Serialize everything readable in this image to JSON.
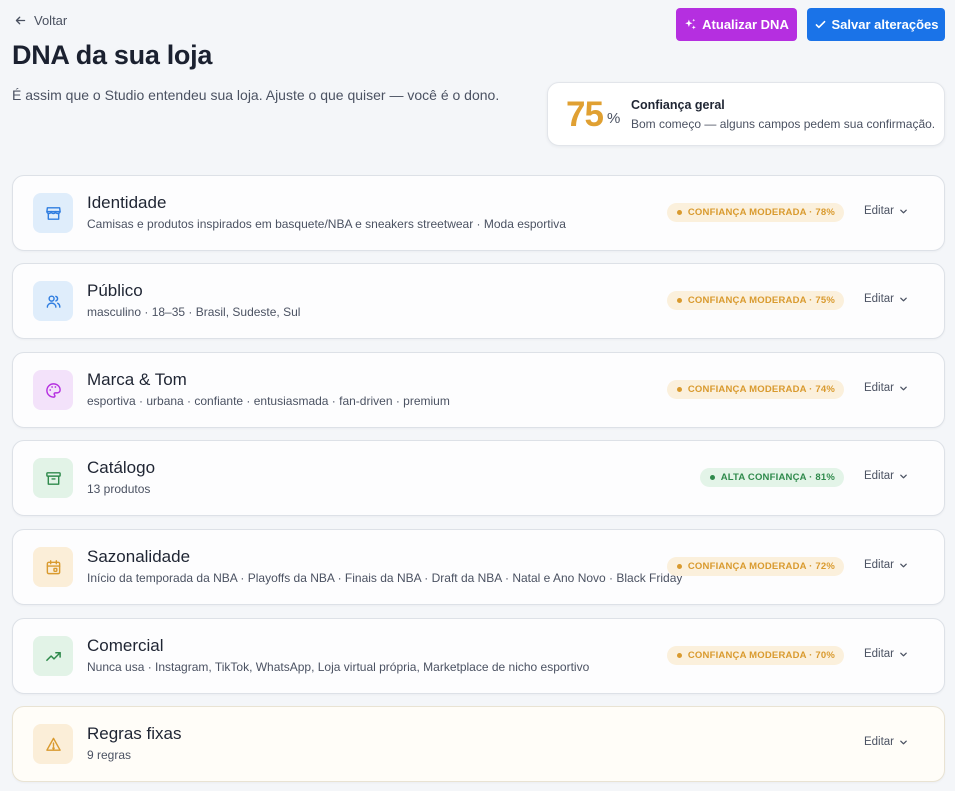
{
  "header": {
    "back_label": "Voltar",
    "title": "DNA da sua loja",
    "subtitle": "É assim que o Studio entendeu sua loja. Ajuste o que quiser — você é o dono.",
    "refresh_label": "Atualizar DNA",
    "save_label": "Salvar alterações"
  },
  "confidence": {
    "value": "75",
    "unit": "%",
    "title": "Confiança geral",
    "description": "Bom começo — alguns campos pedem sua confirmação."
  },
  "colors": {
    "accent_purple": "#b52fe0",
    "accent_blue": "#1a73e8",
    "confidence_orange": "#e0a032",
    "confidence_green": "#2f8a4c"
  },
  "sections": [
    {
      "title": "Identidade",
      "description": "Camisas e produtos inspirados em basquete/NBA e sneakers streetwear · Moda esportiva",
      "badge": "CONFIANÇA MODERADA · 78%",
      "edit_label": "Editar",
      "icon": "store-icon"
    },
    {
      "title": "Público",
      "description": "masculino · 18–35 · Brasil, Sudeste, Sul",
      "badge": "CONFIANÇA MODERADA · 75%",
      "edit_label": "Editar",
      "icon": "users-icon"
    },
    {
      "title": "Marca & Tom",
      "description": "esportiva · urbana · confiante · entusiasmada · fan-driven · premium",
      "badge": "CONFIANÇA MODERADA · 74%",
      "edit_label": "Editar",
      "icon": "palette-icon"
    },
    {
      "title": "Catálogo",
      "description": "13 produtos",
      "badge": "ALTA CONFIANÇA · 81%",
      "edit_label": "Editar",
      "icon": "archive-icon"
    },
    {
      "title": "Sazonalidade",
      "description": "Início da temporada da NBA · Playoffs da NBA · Finais da NBA · Draft da NBA · Natal e Ano Novo · Black Friday",
      "badge": "CONFIANÇA MODERADA · 72%",
      "edit_label": "Editar",
      "icon": "calendar-icon"
    },
    {
      "title": "Comercial",
      "description": "Nunca usa · Instagram, TikTok, WhatsApp, Loja virtual própria, Marketplace de nicho esportivo",
      "badge": "CONFIANÇA MODERADA · 70%",
      "edit_label": "Editar",
      "icon": "trending-up-icon"
    },
    {
      "title": "Regras fixas",
      "description": "9 regras",
      "edit_label": "Editar",
      "icon": "warning-icon"
    }
  ]
}
